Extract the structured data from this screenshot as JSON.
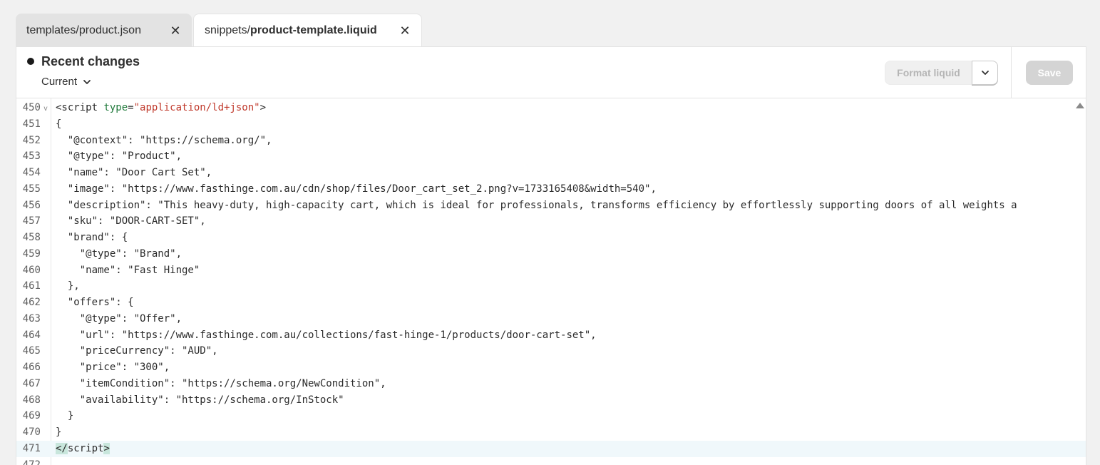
{
  "tabs": [
    {
      "prefix": "templates/",
      "name": "product.json",
      "active": false
    },
    {
      "prefix": "snippets/",
      "name": "product-template.liquid",
      "active": true
    }
  ],
  "header": {
    "title": "Recent changes",
    "version_select": "Current",
    "format_label": "Format liquid",
    "save_label": "Save"
  },
  "editor": {
    "current_line": 471,
    "lines": [
      {
        "n": "450",
        "parts": [
          {
            "t": "<script ",
            "c": ""
          },
          {
            "t": "type",
            "c": "attr"
          },
          {
            "t": "=",
            "c": ""
          },
          {
            "t": "\"application/ld+json\"",
            "c": "str"
          },
          {
            "t": ">",
            "c": ""
          }
        ],
        "fold": "v"
      },
      {
        "n": "451",
        "parts": [
          {
            "t": "{",
            "c": ""
          }
        ]
      },
      {
        "n": "452",
        "parts": [
          {
            "t": "  \"@context\": \"https://schema.org/\",",
            "c": ""
          }
        ]
      },
      {
        "n": "453",
        "parts": [
          {
            "t": "  \"@type\": \"Product\",",
            "c": ""
          }
        ]
      },
      {
        "n": "454",
        "parts": [
          {
            "t": "  \"name\": \"Door Cart Set\",",
            "c": ""
          }
        ]
      },
      {
        "n": "455",
        "parts": [
          {
            "t": "  \"image\": \"https://www.fasthinge.com.au/cdn/shop/files/Door_cart_set_2.png?v=1733165408&width=540\",",
            "c": ""
          }
        ]
      },
      {
        "n": "456",
        "parts": [
          {
            "t": "  \"description\": \"This heavy-duty, high-capacity cart, which is ideal for professionals, transforms efficiency by effortlessly supporting doors of all weights a",
            "c": ""
          }
        ]
      },
      {
        "n": "457",
        "parts": [
          {
            "t": "  \"sku\": \"DOOR-CART-SET\",",
            "c": ""
          }
        ]
      },
      {
        "n": "458",
        "parts": [
          {
            "t": "  \"brand\": {",
            "c": ""
          }
        ]
      },
      {
        "n": "459",
        "parts": [
          {
            "t": "    \"@type\": \"Brand\",",
            "c": ""
          }
        ]
      },
      {
        "n": "460",
        "parts": [
          {
            "t": "    \"name\": \"Fast Hinge\"",
            "c": ""
          }
        ]
      },
      {
        "n": "461",
        "parts": [
          {
            "t": "  },",
            "c": ""
          }
        ]
      },
      {
        "n": "462",
        "parts": [
          {
            "t": "  \"offers\": {",
            "c": ""
          }
        ]
      },
      {
        "n": "463",
        "parts": [
          {
            "t": "    \"@type\": \"Offer\",",
            "c": ""
          }
        ]
      },
      {
        "n": "464",
        "parts": [
          {
            "t": "    \"url\": \"https://www.fasthinge.com.au/collections/fast-hinge-1/products/door-cart-set\",",
            "c": ""
          }
        ]
      },
      {
        "n": "465",
        "parts": [
          {
            "t": "    \"priceCurrency\": \"AUD\",",
            "c": ""
          }
        ]
      },
      {
        "n": "466",
        "parts": [
          {
            "t": "    \"price\": \"300\",",
            "c": ""
          }
        ]
      },
      {
        "n": "467",
        "parts": [
          {
            "t": "    \"itemCondition\": \"https://schema.org/NewCondition\",",
            "c": ""
          }
        ]
      },
      {
        "n": "468",
        "parts": [
          {
            "t": "    \"availability\": \"https://schema.org/InStock\"",
            "c": ""
          }
        ]
      },
      {
        "n": "469",
        "parts": [
          {
            "t": "  }",
            "c": ""
          }
        ]
      },
      {
        "n": "470",
        "parts": [
          {
            "t": "}",
            "c": ""
          }
        ]
      },
      {
        "n": "471",
        "parts": [
          {
            "t": "</",
            "c": "tag-hl"
          },
          {
            "t": "script",
            "c": ""
          },
          {
            "t": ">",
            "c": "tag-hl"
          }
        ]
      },
      {
        "n": "472",
        "parts": [
          {
            "t": "",
            "c": ""
          }
        ]
      }
    ]
  },
  "colors": {
    "attr": "#217a3c",
    "string": "#c0392b",
    "current_line_bg": "#f0f8fb",
    "save_disabled": "#d4d4d4"
  },
  "icons": {
    "tab_close": "close-icon",
    "version_chevron": "chevron-down-icon",
    "format_dropdown": "chevron-down-icon",
    "fold": "fold-arrow-icon",
    "scroll_up": "scroll-up-arrow-icon"
  }
}
